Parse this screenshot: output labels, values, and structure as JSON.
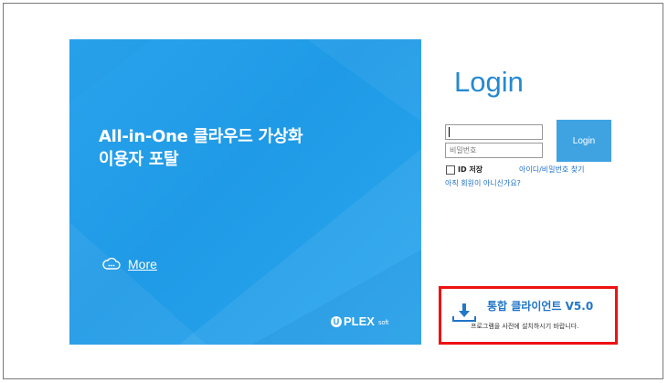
{
  "hero": {
    "title_line1": "All-in-One 클라우드 가상화",
    "title_line2": "이용자 포탈",
    "more_label": "More",
    "brand_mark": "U",
    "brand_name": "PLEX",
    "brand_suffix": "soft"
  },
  "login": {
    "title": "Login",
    "id_value": "",
    "password_placeholder": "비밀번호",
    "button_label": "Login",
    "save_id_label": "ID 저장",
    "find_link": "아이디/비밀번호 찾기",
    "signup_link": "아직 회원이 아니신가요?"
  },
  "client": {
    "title": "통합 클라이언트 V5.0",
    "description": "프로그램을 사전에 설치하시기 바랍니다."
  },
  "colors": {
    "hero_blue": "#1f9ae6",
    "accent_blue": "#2589d0",
    "highlight_red": "#ee1111"
  }
}
